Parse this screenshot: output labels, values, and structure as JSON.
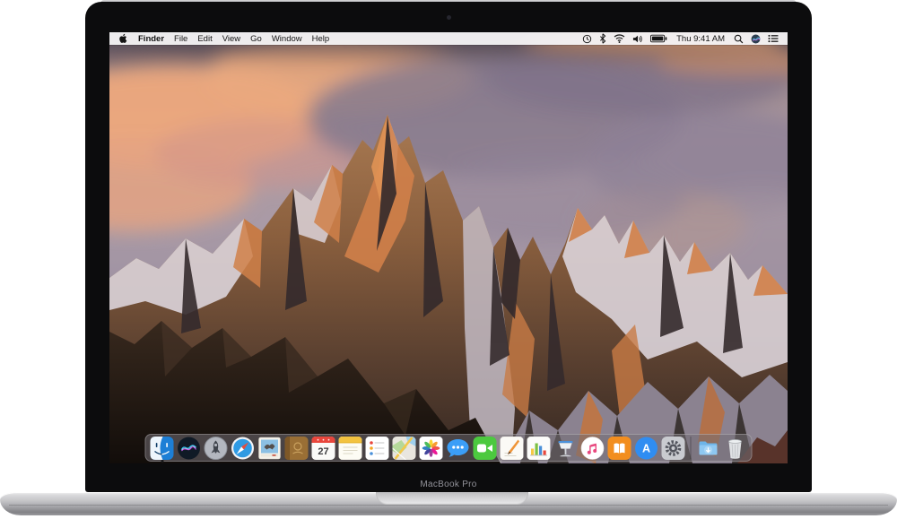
{
  "device": {
    "type": "MacBook Pro product view with macOS Sierra desktop",
    "model_label": "MacBook Pro"
  },
  "menu_bar": {
    "apple_menu_icon": "apple-logo",
    "menus": [
      "Finder",
      "File",
      "Edit",
      "View",
      "Go",
      "Window",
      "Help"
    ],
    "active_app": "Finder",
    "time": "Thu 9:41 AM",
    "status_icons": [
      "clock",
      "bluetooth",
      "wifi",
      "volume",
      "battery",
      "spotlight-search",
      "siri",
      "notification-center"
    ]
  },
  "desktop": {
    "wallpaper_name": "macOS Sierra default — Lone Pine Peak at sunset",
    "colors": {
      "sky_top": "#4b4350",
      "sky_lavender": "#a99aa6",
      "cloud_orange": "#eda87c",
      "rock_sunlit": "#d08049",
      "rock_shadow": "#342a2c",
      "snow": "#dcd4da",
      "foreground_rock": "#241c17",
      "menubar_bg": "#f7f5f6",
      "dock_bg": "#736e74"
    }
  },
  "dock": {
    "items": [
      "finder",
      "siri",
      "launchpad",
      "safari",
      "mail",
      "contacts",
      "calendar",
      "notes",
      "reminders",
      "maps",
      "photos",
      "messages",
      "facetime",
      "pages",
      "numbers",
      "keynote",
      "itunes",
      "ibooks",
      "app-store",
      "system-preferences",
      "downloads",
      "trash"
    ],
    "calendar_day": "27",
    "app_store_glyph": "A",
    "running_apps": [
      "finder"
    ]
  }
}
